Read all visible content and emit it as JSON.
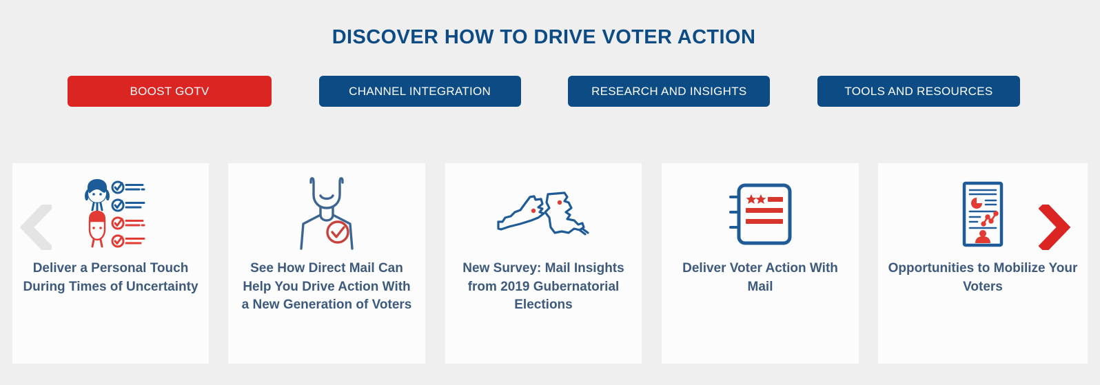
{
  "header": {
    "title": "DISCOVER HOW TO DRIVE VOTER ACTION",
    "title_color": "#0d4b85"
  },
  "tabs": {
    "active_index": 0,
    "active_color": "#da2522",
    "inactive_color": "#0d4b85",
    "items": [
      {
        "label": "BOOST GOTV",
        "state": "active"
      },
      {
        "label": "CHANNEL INTEGRATION",
        "state": "inactive"
      },
      {
        "label": "RESEARCH AND INSIGHTS",
        "state": "inactive"
      },
      {
        "label": "TOOLS AND RESOURCES",
        "state": "inactive"
      }
    ]
  },
  "carousel": {
    "background": "#efefef",
    "card_background": "#fcfcfc",
    "title_color": "#3d5a7d",
    "prev_arrow": {
      "name": "chevron-left-icon",
      "color": "#e4e4e4",
      "enabled": false
    },
    "next_arrow": {
      "name": "chevron-right-icon",
      "color": "#da2522",
      "enabled": true
    },
    "cards": [
      {
        "title": "Deliver a Personal Touch During Times of Uncertainty",
        "icon": "people-checklist-icon"
      },
      {
        "title": "See How Direct Mail Can Help You Drive Action With a New Generation of Voters",
        "icon": "person-check-badge-icon"
      },
      {
        "title": "New Survey: Mail Insights from 2019 Gubernatorial Elections",
        "icon": "state-maps-icon"
      },
      {
        "title": "Deliver Voter Action With Mail",
        "icon": "patriotic-notebook-icon"
      },
      {
        "title": "Opportunities to Mobilize Your Voters",
        "icon": "report-document-icon"
      }
    ]
  },
  "palette": {
    "brand_blue": "#0d4b85",
    "brand_red": "#da2522",
    "icon_blue": "#1b5c99",
    "icon_red": "#e23b33",
    "page_bg": "#efefef"
  }
}
